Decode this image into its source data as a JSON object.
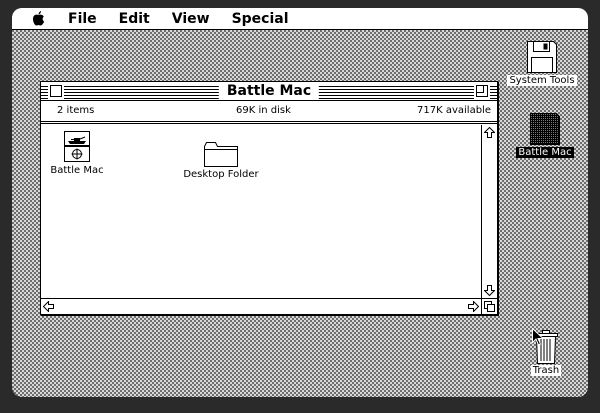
{
  "menubar": {
    "apple_icon": "apple-icon",
    "items": [
      "File",
      "Edit",
      "View",
      "Special"
    ]
  },
  "window": {
    "title": "Battle Mac",
    "info": {
      "items": "2 items",
      "in_disk": "69K in disk",
      "available": "717K available"
    },
    "icons": [
      {
        "label": "Battle Mac",
        "icon": "battleship-app-icon"
      },
      {
        "label": "Desktop Folder",
        "icon": "folder-icon"
      }
    ]
  },
  "desktop": {
    "system_tools": {
      "label": "System Tools",
      "icon": "floppy-disk-icon"
    },
    "battle_mac": {
      "label": "Battle Mac",
      "icon": "disk-icon"
    },
    "trash": {
      "label": "Trash",
      "icon": "trash-icon"
    }
  }
}
